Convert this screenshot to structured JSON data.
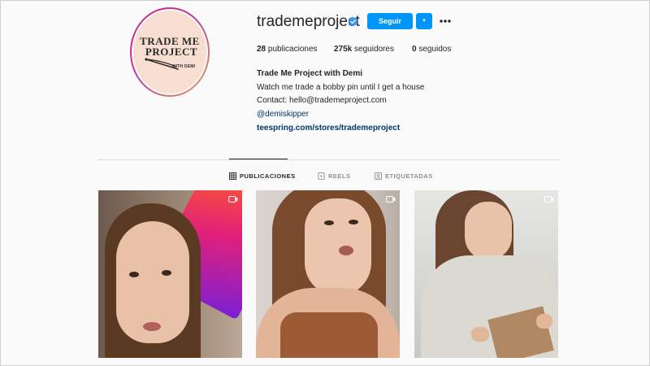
{
  "profile": {
    "username": "trademeproject",
    "verified": true,
    "follow_label": "Seguir",
    "dropdown_glyph": "▼",
    "avatar_logo": {
      "line1": "TRADE ME",
      "line2": "PROJECT",
      "line3": "WITH DEMI"
    }
  },
  "stats": {
    "posts_count": "28",
    "posts_label": "publicaciones",
    "followers_count": "275k",
    "followers_label": "seguidores",
    "following_count": "0",
    "following_label": "seguidos"
  },
  "bio": {
    "name": "Trade Me Project with Demi",
    "line1": "Watch me trade a bobby pin until I get a house",
    "line2": "Contact: hello@trademeproject.com",
    "tag": "@demiskipper",
    "link": "teespring.com/stores/trademeproject"
  },
  "tabs": [
    {
      "label": "PUBLICACIONES",
      "icon": "grid-icon",
      "active": true
    },
    {
      "label": "REELS",
      "icon": "reels-icon",
      "active": false
    },
    {
      "label": "ETIQUETADAS",
      "icon": "tagged-icon",
      "active": false
    }
  ],
  "posts": [
    {
      "type": "reel",
      "icon": "reel-icon"
    },
    {
      "type": "reel",
      "icon": "reel-icon"
    },
    {
      "type": "reel",
      "icon": "reel-icon"
    }
  ],
  "colors": {
    "accent": "#0095f6",
    "link": "#00376b",
    "text": "#262626",
    "muted": "#8e8e8e",
    "background": "#fafafa"
  }
}
